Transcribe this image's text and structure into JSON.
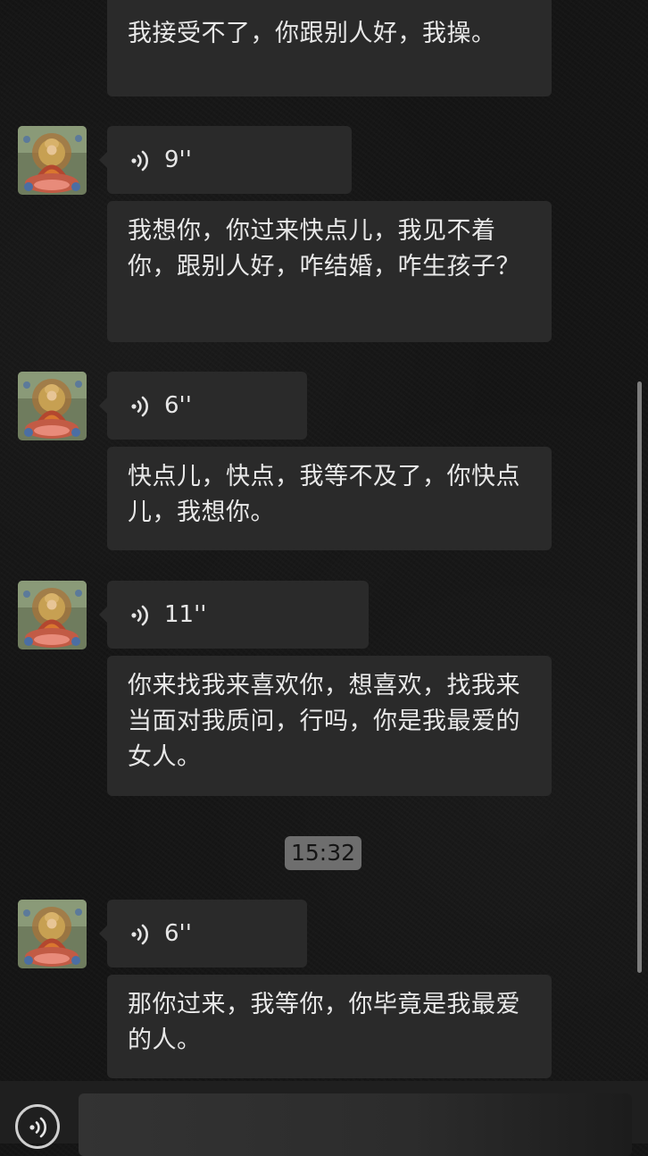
{
  "messages": [
    {
      "type": "text",
      "text": "我接受不了，你跟别人好，我操。"
    },
    {
      "type": "voice",
      "duration": "9''"
    },
    {
      "type": "text",
      "text": "我想你，你过来快点儿，我见不着你，跟别人好，咋结婚，咋生孩子？"
    },
    {
      "type": "voice",
      "duration": "6''"
    },
    {
      "type": "text",
      "text": "快点儿，快点，我等不及了，你快点儿，我想你。"
    },
    {
      "type": "voice",
      "duration": "11''"
    },
    {
      "type": "text",
      "text": "你来找我来喜欢你，想喜欢，找我来当面对我质问，行吗，你是我最爱的女人。"
    },
    {
      "type": "time",
      "text": "15:32"
    },
    {
      "type": "voice",
      "duration": "6''"
    },
    {
      "type": "text",
      "text": "那你过来，我等你，你毕竟是我最爱的人。"
    }
  ],
  "icons": {
    "avatar": "thangka-avatar",
    "voice": "voice-wave-icon",
    "voice_toggle": "voice-input-toggle-icon"
  },
  "colors": {
    "background": "#151515",
    "bubble": "#2a2a2a",
    "text": "#e8e8e8",
    "timestamp_bg": "#6e6e6e"
  }
}
